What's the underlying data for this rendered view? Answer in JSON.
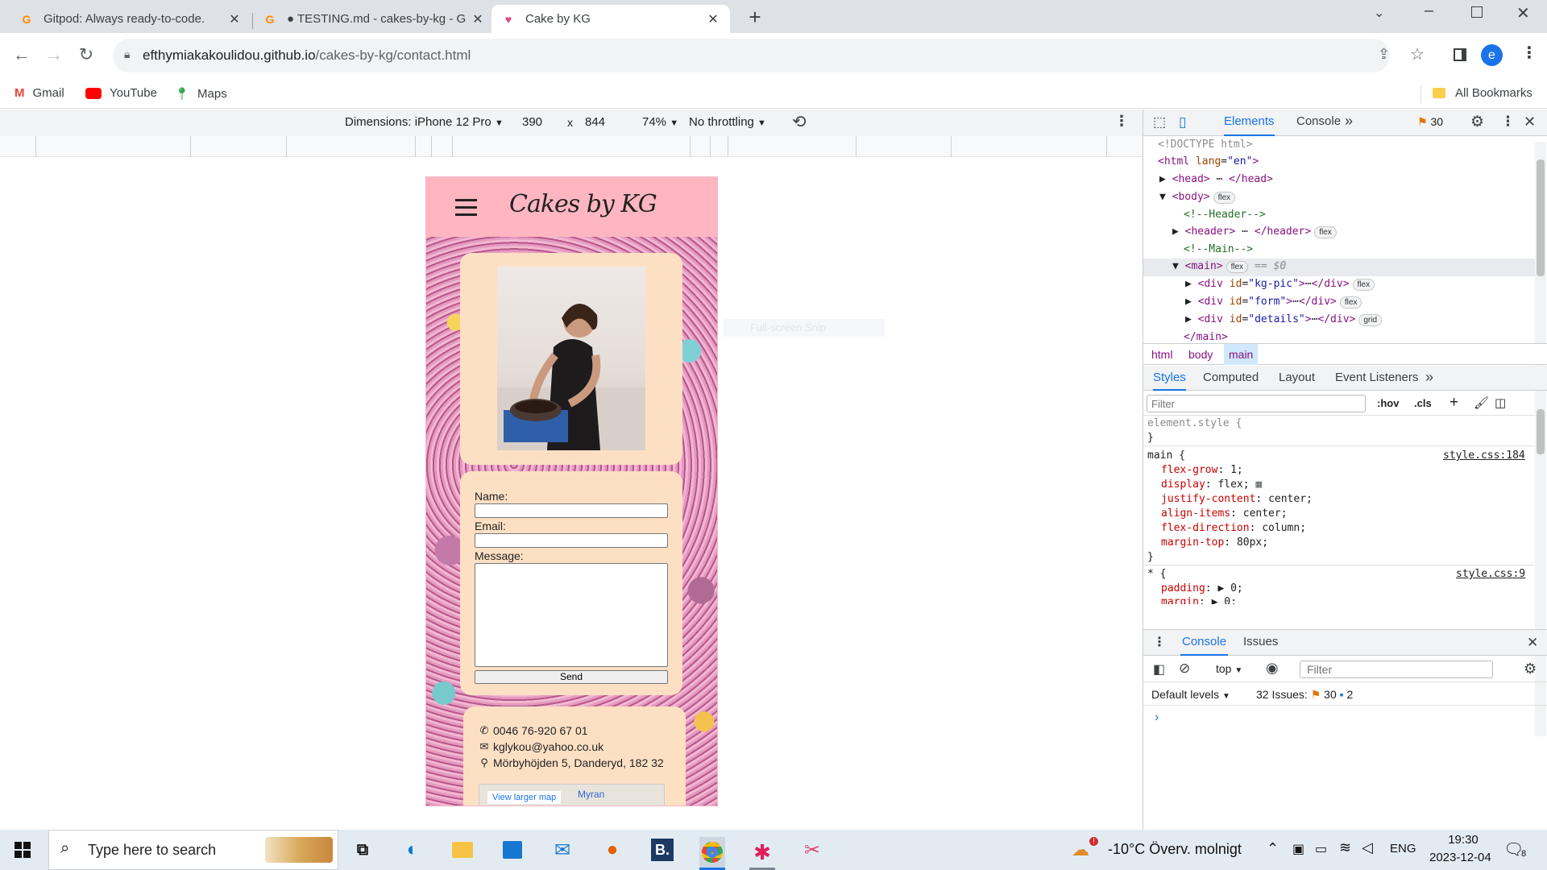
{
  "browser": {
    "tabs": [
      {
        "title": "Gitpod: Always ready-to-code.",
        "icon": "gitpod-icon",
        "active": false
      },
      {
        "title": "● TESTING.md - cakes-by-kg - G",
        "icon": "gitpod-icon",
        "active": false
      },
      {
        "title": "Cake by KG",
        "icon": "cake-icon",
        "active": true
      }
    ],
    "url_host": "efthymiakakoulidou.github.io",
    "url_path": "/cakes-by-kg/contact.html",
    "profile_initial": "e",
    "bookmarks": [
      "Gmail",
      "YouTube",
      "Maps"
    ],
    "all_bookmarks": "All Bookmarks"
  },
  "device_toolbar": {
    "dimensions_label": "Dimensions: iPhone 12 Pro",
    "width": "390",
    "times": "x",
    "height": "844",
    "zoom": "74%",
    "throttling": "No throttling"
  },
  "site": {
    "brand": "Cakes by KG",
    "form": {
      "name_label": "Name:",
      "email_label": "Email:",
      "message_label": "Message:",
      "send_label": "Send"
    },
    "details": {
      "phone": "0046 76-920 67 01",
      "email": "kglykou@yahoo.co.uk",
      "address": "Mörbyhöjden 5, Danderyd, 182 32"
    },
    "map": {
      "larger_map": "View larger map",
      "place": "Myran"
    }
  },
  "ghost_text": "Full-screen Snip",
  "devtools": {
    "tabs": [
      "Elements",
      "Console"
    ],
    "warning_count": "30",
    "dom": {
      "doctype": "<!DOCTYPE html>",
      "html_open": "<html",
      "lang_attr": "lang",
      "lang_val": "\"en\"",
      "head": "<head>",
      "head_close": "</head>",
      "body": "<body>",
      "header_comment": "<!--Header-->",
      "header": "<header>",
      "header_close": "</header>",
      "main_comment": "<!--Main-->",
      "main": "<main>",
      "main_sel": "== $0",
      "div": "<div",
      "id_attr": "id",
      "div_ids": [
        "\"kg-pic\"",
        "\"form\"",
        "\"details\""
      ],
      "div_close": "</div>",
      "main_close": "</main>",
      "pill_flex": "flex",
      "pill_grid": "grid"
    },
    "breadcrumbs": [
      "html",
      "body",
      "main"
    ],
    "style_tabs": [
      "Styles",
      "Computed",
      "Layout",
      "Event Listeners"
    ],
    "filter_placeholder": "Filter",
    "hov": ":hov",
    "cls": ".cls",
    "element_style": "element.style {",
    "close_brace": "}",
    "main_rule": {
      "selector": "main {",
      "source": "style.css:184",
      "props": [
        [
          "flex-grow",
          "1;"
        ],
        [
          "display",
          "flex;"
        ],
        [
          "justify-content",
          "center;"
        ],
        [
          "align-items",
          "center;"
        ],
        [
          "flex-direction",
          "column;"
        ],
        [
          "margin-top",
          "80px;"
        ]
      ]
    },
    "star_rule": {
      "selector": "* {",
      "source": "style.css:9",
      "props": [
        [
          "padding",
          "▶ 0;"
        ],
        [
          "margin",
          "▶ 0;"
        ]
      ]
    },
    "drawer_tabs": [
      "Console",
      "Issues"
    ],
    "console_context": "top",
    "console_filter": "Filter",
    "default_levels": "Default levels",
    "issues_label": "32 Issues:",
    "issues_warn": "30",
    "issues_info": "2",
    "prompt": "›"
  },
  "taskbar": {
    "search_placeholder": "Type here to search",
    "weather": "-10°C Överv. molnigt",
    "lang": "ENG",
    "time": "19:30",
    "date": "2023-12-04",
    "notif_count": "8"
  }
}
